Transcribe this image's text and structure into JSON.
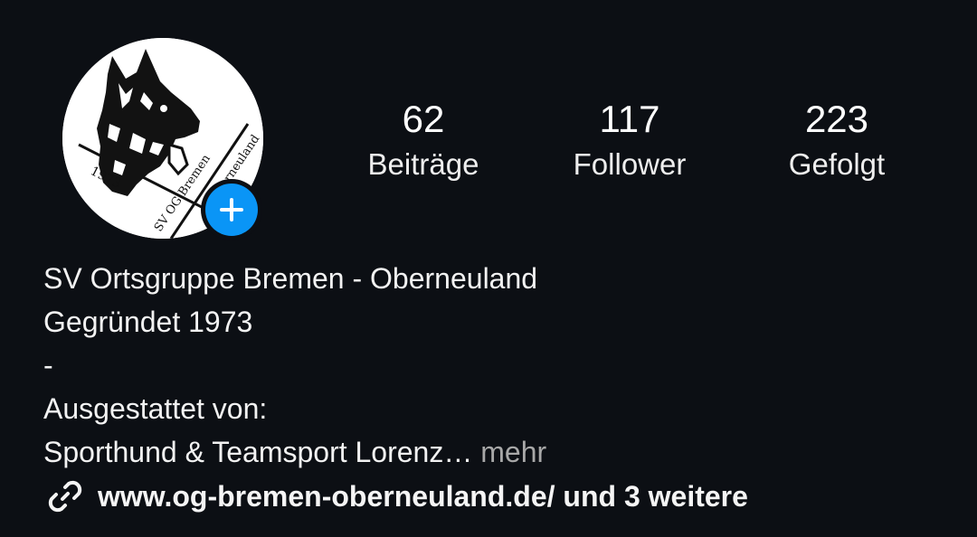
{
  "profile": {
    "avatar_alt": "SV OG Bremen Oberneuland logo",
    "avatar_text": {
      "year": "1973",
      "club": "SV OG Bremen",
      "place": "Oberneuland"
    },
    "add_icon": "plus-icon",
    "stats": [
      {
        "count": "62",
        "label": "Beiträge"
      },
      {
        "count": "117",
        "label": "Follower"
      },
      {
        "count": "223",
        "label": "Gefolgt"
      }
    ],
    "bio": {
      "name": "SV Ortsgruppe Bremen - Oberneuland",
      "line2": "Gegründet 1973",
      "line3": "-",
      "line4": "Ausgestattet von:",
      "line5": "Sporthund & Teamsport Lorenz…",
      "more": " mehr"
    },
    "link": {
      "icon": "link-icon",
      "text": "www.og-bremen-oberneuland.de/ und 3 weitere"
    }
  },
  "colors": {
    "background": "#0c0f14",
    "accent": "#0a95f6",
    "muted": "#a8a8a8"
  }
}
